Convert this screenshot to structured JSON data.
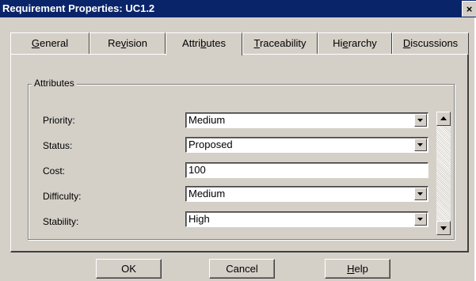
{
  "window": {
    "title": "Requirement Properties: UC1.2",
    "close_glyph": "×"
  },
  "tabs": [
    {
      "label": "General",
      "mnemonic_index": 0,
      "active": false
    },
    {
      "label": "Revision",
      "mnemonic_index": 2,
      "active": false
    },
    {
      "label": "Attributes",
      "mnemonic_index": 5,
      "active": true
    },
    {
      "label": "Traceability",
      "mnemonic_index": 0,
      "active": false
    },
    {
      "label": "Hierarchy",
      "mnemonic_index": 2,
      "active": false
    },
    {
      "label": "Discussions",
      "mnemonic_index": 0,
      "active": false
    }
  ],
  "attributes_group": {
    "legend": "Attributes",
    "fields": [
      {
        "label": "Priority:",
        "type": "combo",
        "value": "Medium"
      },
      {
        "label": "Status:",
        "type": "combo",
        "value": "Proposed"
      },
      {
        "label": "Cost:",
        "type": "text",
        "value": "100"
      },
      {
        "label": "Difficulty:",
        "type": "combo",
        "value": "Medium"
      },
      {
        "label": "Stability:",
        "type": "combo",
        "value": "High"
      }
    ]
  },
  "buttons": {
    "ok": "OK",
    "cancel": "Cancel",
    "help": "Help"
  },
  "colors": {
    "titlebar": "#0a246a",
    "face": "#d4d0c8"
  },
  "icons": {
    "close": "close-icon",
    "dropdown": "chevron-down-icon",
    "scroll_up": "arrow-up-icon",
    "scroll_down": "arrow-down-icon"
  }
}
